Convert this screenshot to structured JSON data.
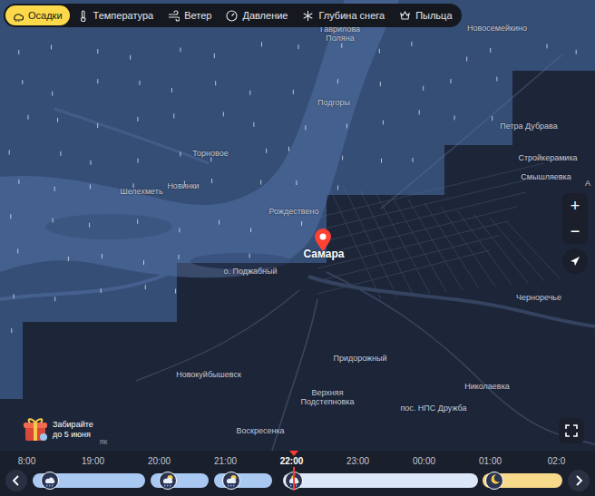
{
  "tabs": [
    {
      "label": "Осадки",
      "selected": true
    },
    {
      "label": "Температура",
      "selected": false
    },
    {
      "label": "Ветер",
      "selected": false
    },
    {
      "label": "Давление",
      "selected": false
    },
    {
      "label": "Глубина снега",
      "selected": false
    },
    {
      "label": "Пыльца",
      "selected": false
    }
  ],
  "map": {
    "labels": [
      {
        "text": "Гаврилова Поляна",
        "kind": "village"
      },
      {
        "text": "Новосемейкино",
        "kind": "village"
      },
      {
        "text": "Подгоры",
        "kind": "village"
      },
      {
        "text": "Петра Дубрава",
        "kind": "village"
      },
      {
        "text": "Торновое",
        "kind": "village"
      },
      {
        "text": "Стройкерамика",
        "kind": "village"
      },
      {
        "text": "Смышляевка",
        "kind": "village"
      },
      {
        "text": "Шелехметь",
        "kind": "village"
      },
      {
        "text": "Новинки",
        "kind": "village"
      },
      {
        "text": "Рождествено",
        "kind": "village"
      },
      {
        "text": "Самара",
        "kind": "city"
      },
      {
        "text": "о. Поджабный",
        "kind": "village"
      },
      {
        "text": "Черноречье",
        "kind": "village"
      },
      {
        "text": "Новокуйбышевск",
        "kind": "village"
      },
      {
        "text": "Придорожный",
        "kind": "village"
      },
      {
        "text": "Верхняя Подстепновка",
        "kind": "village"
      },
      {
        "text": "пос. НПС Дружба",
        "kind": "village"
      },
      {
        "text": "Николаевка",
        "kind": "village"
      },
      {
        "text": "Воскресенка",
        "kind": "village"
      },
      {
        "text": "А",
        "kind": "village"
      },
      {
        "text": "ЯК",
        "kind": "mark"
      }
    ]
  },
  "controls": {
    "zoom_in": "+",
    "zoom_out": "−"
  },
  "promo": {
    "lines": [
      "Забирайте",
      "до 5 июня"
    ]
  },
  "timeline": {
    "hours": [
      {
        "time": "8:00",
        "selected": false
      },
      {
        "time": "19:00",
        "selected": false
      },
      {
        "time": "20:00",
        "selected": false
      },
      {
        "time": "21:00",
        "selected": false
      },
      {
        "time": "22:00",
        "selected": true
      },
      {
        "time": "23:00",
        "selected": false
      },
      {
        "time": "00:00",
        "selected": false
      },
      {
        "time": "01:00",
        "selected": false
      },
      {
        "time": "02:0",
        "selected": false
      }
    ],
    "segments": [
      {
        "kind": "rain",
        "color": "#a9c8f2"
      },
      {
        "kind": "partly-rain",
        "color": "#a9c8f2"
      },
      {
        "kind": "partly-rain",
        "color": "#a9c8f2"
      },
      {
        "kind": "night-rain",
        "color": "#dbe6f8"
      },
      {
        "kind": "night",
        "color": "#f7d98c"
      }
    ]
  }
}
